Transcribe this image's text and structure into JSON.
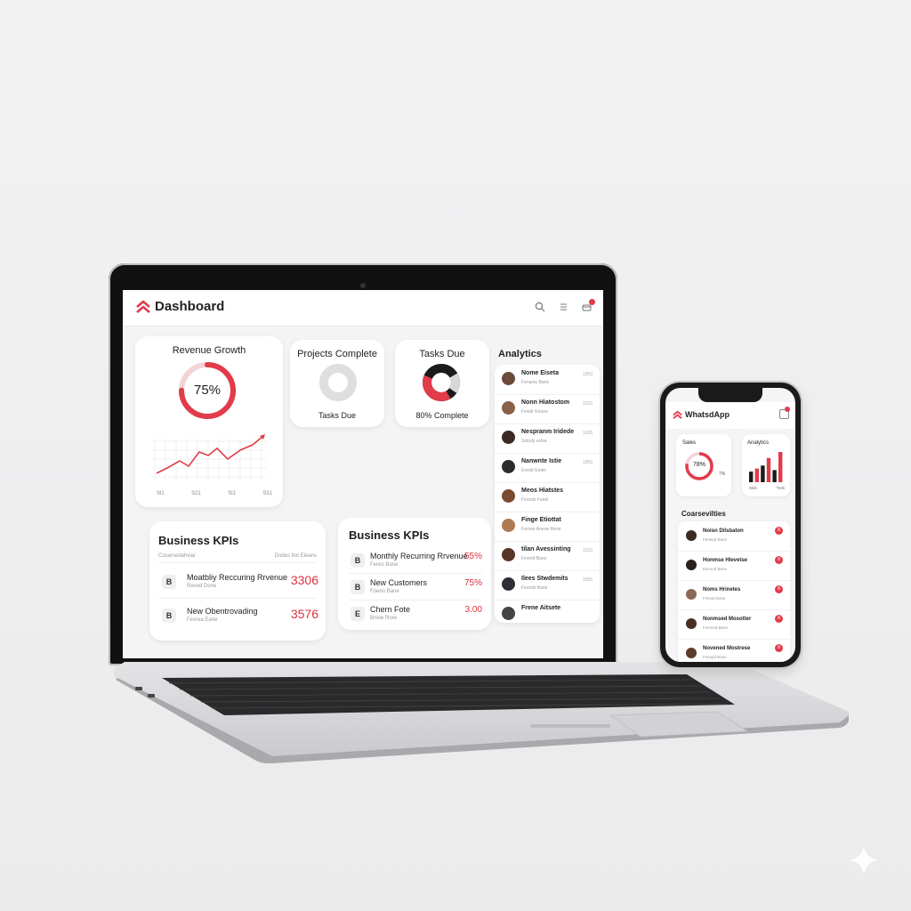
{
  "colors": {
    "accent": "#e23b4a",
    "dark": "#1b1b1b",
    "background": "#f0f0f1"
  },
  "laptop": {
    "header": {
      "title": "Dashboard",
      "icons": [
        "search-icon",
        "menu-icon",
        "notifications-icon"
      ]
    },
    "revenue_growth": {
      "title": "Revenue Growth",
      "percent_label": "75%",
      "progress": 0.75,
      "chart_ticks": [
        "Sl1",
        "S21",
        "Sl1",
        "S31"
      ]
    },
    "projects_complete": {
      "title": "Projects Complete",
      "caption": "Tasks Due"
    },
    "tasks_due": {
      "title": "Tasks Due",
      "caption": "80% Complete"
    },
    "analytics": {
      "title": "Analytics",
      "items": [
        {
          "name": "Nome Eiseta",
          "sub": "Fenams Bane",
          "value": "1353"
        },
        {
          "name": "Nonn Hiatostom",
          "sub": "Fewdr Enaoe",
          "value": "1153"
        },
        {
          "name": "Nespranm Iridede",
          "sub": "Satcdy eslsa",
          "value": "1105"
        },
        {
          "name": "Nanwnte Istie",
          "sub": "Enesk Eeaie",
          "value": "1353"
        },
        {
          "name": "Meos Hiatstes",
          "sub": "Fesnds Fanel",
          "value": ""
        },
        {
          "name": "Finge Etiottat",
          "sub": "Farsee Anene Rene",
          "value": ""
        },
        {
          "name": "tilan Avessinting",
          "sub": "Fesmd Bane",
          "value": "1153"
        },
        {
          "name": "Ilees Stwdemits",
          "sub": "Fesnds Bane",
          "value": "1055"
        },
        {
          "name": "Frene Aitsete",
          "sub": "",
          "value": ""
        }
      ]
    },
    "kpis_left": {
      "title": "Business KPIs",
      "subheader_left": "Cosarsedahviai",
      "subheader_right": "Dodes Itot Eleans",
      "rows": [
        {
          "icon": "B",
          "label": "Moatbliy Reccuring Rrvenue",
          "sub": "Revod Done",
          "value": "3306"
        },
        {
          "icon": "B",
          "label": "New Obentrovading",
          "sub": "Fevrea Eane",
          "value": "3576"
        }
      ]
    },
    "kpis_right": {
      "title": "Business KPIs",
      "rows": [
        {
          "icon": "B",
          "label": "Monthly Recurring Rrvenue",
          "sub": "Fereo Bane",
          "value": "55%"
        },
        {
          "icon": "B",
          "label": "New Customers",
          "sub": "Foeno Bane",
          "value": "75%"
        },
        {
          "icon": "E",
          "label": "Chern Fote",
          "sub": "Bnioe Rore",
          "value": "3.00"
        }
      ]
    }
  },
  "phone": {
    "header": {
      "title": "WhatsdApp"
    },
    "sales": {
      "title": "Sales",
      "percent_label": "78%",
      "side_label": "7%",
      "progress": 0.78
    },
    "analytics": {
      "title": "Analytics",
      "bars": [
        0.35,
        0.45,
        0.55,
        0.8,
        0.4,
        1.0
      ],
      "x_labels": [
        "Slds",
        "Tiels"
      ]
    },
    "list_title": "Coarsevilties",
    "items": [
      {
        "name": "Noisn Dilsbaton",
        "sub": "Fenepd Bane"
      },
      {
        "name": "Honmse Hlevetse",
        "sub": "Esnood Bane"
      },
      {
        "name": "Noms Hrinetes",
        "sub": "Fesnat Bane"
      },
      {
        "name": "Nonmsed Mosotter",
        "sub": "Fesmed Bane"
      },
      {
        "name": "Novened Mostrese",
        "sub": "Fesepd Bane"
      }
    ]
  }
}
